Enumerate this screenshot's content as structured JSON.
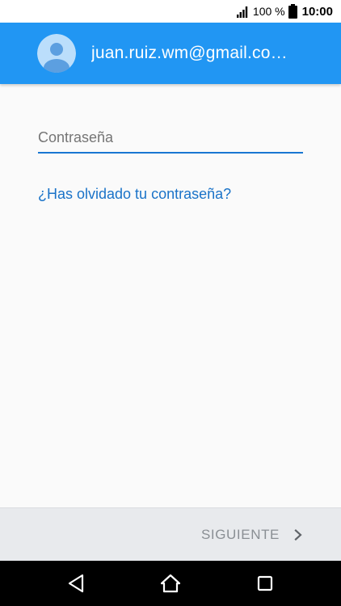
{
  "status_bar": {
    "battery_percent": "100 %",
    "time": "10:00",
    "signal_icon": "signal-icon",
    "battery_icon": "battery-icon"
  },
  "header": {
    "email": "juan.ruiz.wm@gmail.co…",
    "avatar_icon": "account-avatar-icon"
  },
  "form": {
    "password_placeholder": "Contraseña",
    "password_value": "",
    "forgot_password_link": "¿Has olvidado tu contraseña?"
  },
  "actions": {
    "next_label": "SIGUIENTE",
    "next_icon": "chevron-right-icon"
  },
  "colors": {
    "header_blue": "#2196f3",
    "accent_blue": "#1976d2",
    "link_blue": "#1a73c8",
    "action_bar_bg": "#e8eaed",
    "disabled_text": "#8a8f94"
  },
  "nav_bar": {
    "back_icon": "back-icon",
    "home_icon": "home-icon",
    "recents_icon": "recents-icon"
  }
}
